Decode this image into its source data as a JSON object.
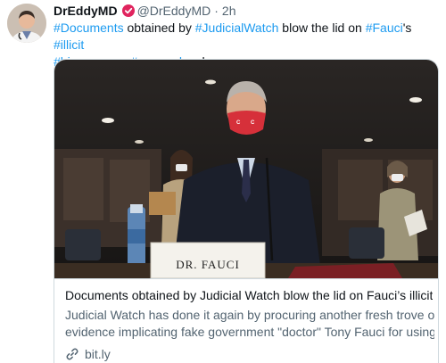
{
  "author": {
    "display_name": "DrEddyMD",
    "handle": "@DrEddyMD",
    "separator": "·",
    "time": "2h"
  },
  "tweet": {
    "segments": [
      {
        "text": "#Documents",
        "type": "hashtag"
      },
      {
        "text": " obtained by ",
        "type": "text"
      },
      {
        "text": "#JudicialWatch",
        "type": "hashtag"
      },
      {
        "text": " blow the lid on ",
        "type": "text"
      },
      {
        "text": "#Fauci",
        "type": "hashtag"
      },
      {
        "text": "'s ",
        "type": "text"
      },
      {
        "text": "#illicit",
        "type": "hashtag"
      },
      {
        "text": "#bioweapons",
        "type": "hashtag"
      },
      {
        "text": " ",
        "type": "text"
      },
      {
        "text": "#research",
        "type": "hashtag"
      },
      {
        "text": " schemes",
        "type": "text"
      }
    ]
  },
  "card": {
    "image_placard": "DR. FAUCI",
    "title": "Documents obtained by Judicial Watch blow the lid on Fauci’s illicit ...",
    "description_line1": "Judicial Watch has done it again by procuring another fresh trove of",
    "description_line2": "evidence implicating fake government \"doctor\" Tony Fauci for using...",
    "domain": "bit.ly"
  },
  "colors": {
    "link": "#1d9bf0",
    "secondary_text": "#536471",
    "border": "#cfd9de",
    "verified_badge": "#e0245e",
    "mask_red": "#d6303a"
  },
  "icons": {
    "verified": "verified-badge-icon",
    "link": "link-icon"
  }
}
